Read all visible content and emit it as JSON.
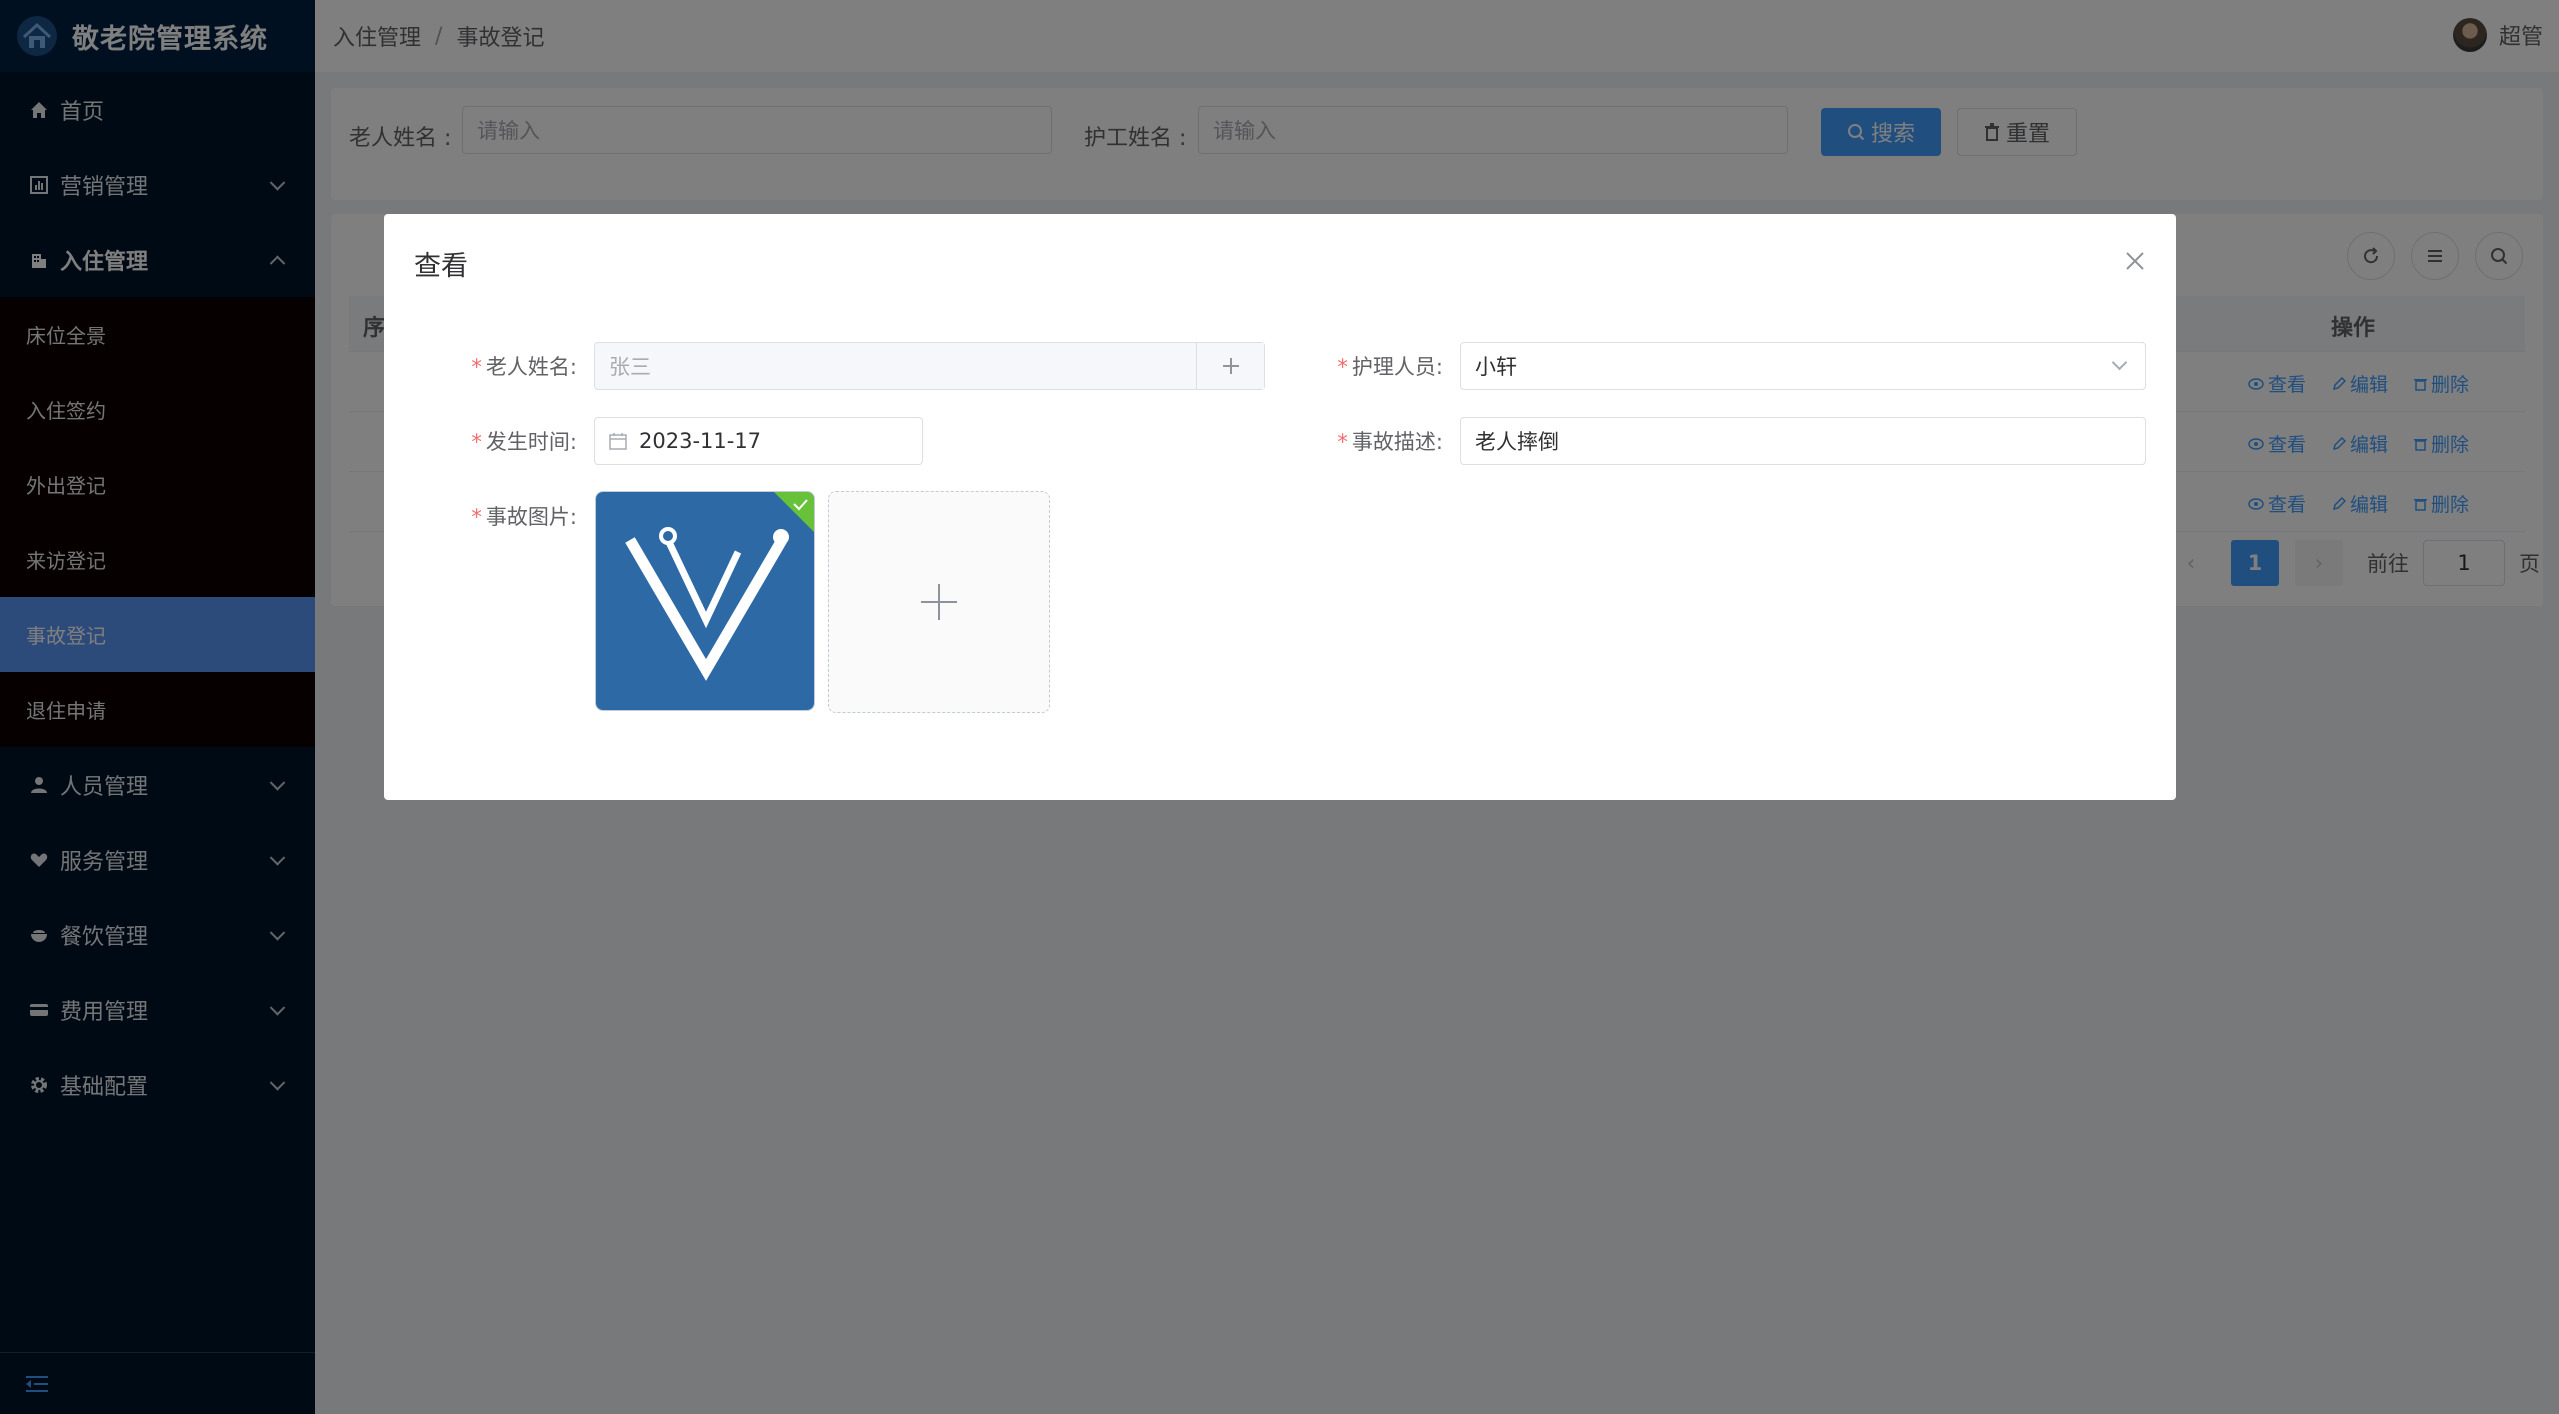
{
  "app": {
    "title": "敬老院管理系统"
  },
  "sidebar": {
    "items": [
      {
        "label": "首页",
        "icon": "home-icon"
      },
      {
        "label": "营销管理",
        "icon": "chart-icon"
      },
      {
        "label": "入住管理",
        "icon": "building-icon",
        "expanded": true
      },
      {
        "label": "人员管理",
        "icon": "user-icon"
      },
      {
        "label": "服务管理",
        "icon": "heart-hand-icon"
      },
      {
        "label": "餐饮管理",
        "icon": "bowl-icon"
      },
      {
        "label": "费用管理",
        "icon": "card-icon"
      },
      {
        "label": "基础配置",
        "icon": "gear-icon"
      }
    ],
    "submenu": [
      {
        "label": "床位全景"
      },
      {
        "label": "入住签约"
      },
      {
        "label": "外出登记"
      },
      {
        "label": "来访登记"
      },
      {
        "label": "事故登记",
        "active": true
      },
      {
        "label": "退住申请"
      }
    ],
    "colors": {
      "background": "#001529",
      "active": "#5a96f5",
      "submenu_bg": "#0f0000"
    }
  },
  "header": {
    "breadcrumb": [
      "入住管理",
      "/",
      "事故登记"
    ],
    "user_name": "超管"
  },
  "search": {
    "elder_label": "老人姓名 :",
    "elder_placeholder": "请输入",
    "nurse_label": "护工姓名 :",
    "nurse_placeholder": "请输入",
    "search_button": "搜索",
    "reset_button": "重置"
  },
  "table": {
    "first_header": "序",
    "ops_header": "操作",
    "row_actions": {
      "view": "查看",
      "edit": "编辑",
      "delete": "删除"
    },
    "row_count": 3
  },
  "pagination": {
    "current_page": "1",
    "goto_label": "前往",
    "goto_value": "1",
    "page_suffix": "页"
  },
  "dialog": {
    "title": "查看",
    "fields": {
      "elder_name": {
        "label": "老人姓名:",
        "value": "张三"
      },
      "nurse": {
        "label": "护理人员:",
        "value": "小轩"
      },
      "time": {
        "label": "发生时间:",
        "value": "2023-11-17"
      },
      "description": {
        "label": "事故描述:",
        "value": "老人摔倒"
      },
      "image": {
        "label": "事故图片:"
      }
    },
    "colors": {
      "required": "#f56c6c",
      "upload_success": "#67c23a",
      "thumb_bg": "#2d6aa5"
    }
  }
}
